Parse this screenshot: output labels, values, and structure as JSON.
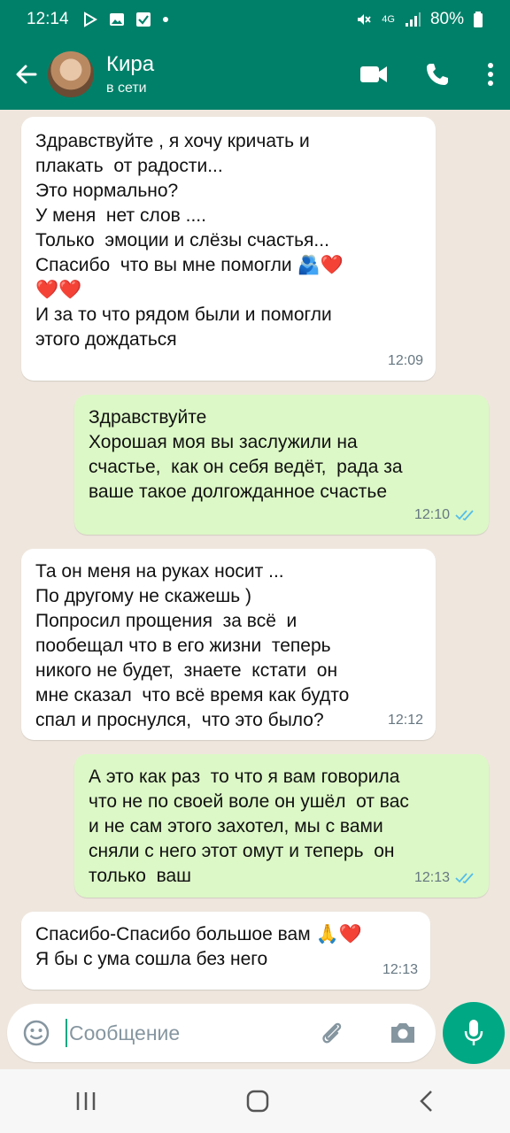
{
  "status_bar": {
    "time": "12:14",
    "network": "4G",
    "battery": "80%"
  },
  "header": {
    "contact_name": "Кира",
    "contact_status": "в сети",
    "icons": [
      "back-arrow-icon",
      "video-call-icon",
      "phone-call-icon",
      "more-vert-icon"
    ]
  },
  "messages": [
    {
      "direction": "in",
      "text": "Здравствуйте , я хочу кричать и\nплакать  от радости...\nЭто нормально?\nУ меня  нет слов ....\nТолько  эмоции и слёзы счастья...\nСпасибо  что вы мне помогли 🫂❤️\n❤️❤️\nИ за то что рядом были и помогли\nэтого дождаться",
      "time": "12:09"
    },
    {
      "direction": "out",
      "text": "Здравствуйте\nХорошая моя вы заслужили на\nсчастье,  как он себя ведёт,  рада за\nваше такое долгожданное счастье",
      "time": "12:10",
      "status": "read"
    },
    {
      "direction": "in",
      "text": "Та он меня на руках носит ...\nПо другому не скажешь )\nПопросил прощения  за всё  и\nпообещал что в его жизни  теперь\nникого не будет,  знаете  кстати  он\nмне сказал  что всё время как будто\nспал и проснулся,  что это было?",
      "time": "12:12"
    },
    {
      "direction": "out",
      "text": "А это как раз  то что я вам говорила\nчто не по своей воле он ушёл  от вас\nи не сам этого захотел, мы с вами\nсняли с него этот омут и теперь  он\nтолько  ваш",
      "time": "12:13",
      "status": "read"
    },
    {
      "direction": "in",
      "text": "Спасибо-Спасибо большое вам 🙏❤️\nЯ бы с ума сошла без него",
      "time": "12:13"
    }
  ],
  "input": {
    "placeholder": "Сообщение"
  },
  "colors": {
    "header": "#008069",
    "accent": "#00a884",
    "incoming_bubble": "#ffffff",
    "outgoing_bubble": "#dcf8c6",
    "read_ticks": "#53bdeb",
    "background": "#efe7de"
  }
}
